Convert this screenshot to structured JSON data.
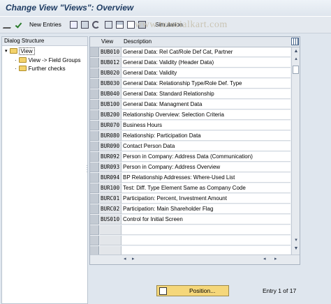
{
  "title": "Change View \"Views\": Overview",
  "toolbar": {
    "new_entries_label": "New Entries",
    "simulation_label": "Simulation",
    "watermark": "www.tutorialkart.com"
  },
  "dialog_structure": {
    "header": "Dialog Structure",
    "items": [
      {
        "label": "View",
        "selected": true
      },
      {
        "label": "View -> Field Groups"
      },
      {
        "label": "Further checks"
      }
    ]
  },
  "table": {
    "columns": [
      "View",
      "Description"
    ],
    "rows": [
      {
        "view": "BUB010",
        "description": "General Data: Rel Cat/Role Def Cat, Partner"
      },
      {
        "view": "BUB012",
        "description": "General Data: Validity (Header Data)"
      },
      {
        "view": "BUB020",
        "description": "General Data: Validity"
      },
      {
        "view": "BUB030",
        "description": "General Data: Relationship Type/Role Def. Type"
      },
      {
        "view": "BUB040",
        "description": "General Data: Standard Relationship"
      },
      {
        "view": "BUB100",
        "description": "General Data: Managment Data"
      },
      {
        "view": "BUB200",
        "description": "Relationship Overview: Selection Criteria"
      },
      {
        "view": "BUR070",
        "description": "Business Hours"
      },
      {
        "view": "BUR080",
        "description": "Relationship: Participation Data"
      },
      {
        "view": "BUR090",
        "description": "Contact Person Data"
      },
      {
        "view": "BUR092",
        "description": "Person in Company: Address Data (Communication)"
      },
      {
        "view": "BUR093",
        "description": "Person in Company: Address Overview"
      },
      {
        "view": "BUR094",
        "description": "BP Relationship Addresses: Where-Used List"
      },
      {
        "view": "BUR100",
        "description": "Test: Diff. Type Element Same as Company Code"
      },
      {
        "view": "BURC01",
        "description": "Participation: Percent, Investment Amount"
      },
      {
        "view": "BURC02",
        "description": "Participation: Main Shareholder Flag"
      },
      {
        "view": "BUS010",
        "description": "Control for Initial Screen"
      }
    ]
  },
  "footer": {
    "position_label": "Position...",
    "entry_text": "Entry 1 of 17"
  }
}
